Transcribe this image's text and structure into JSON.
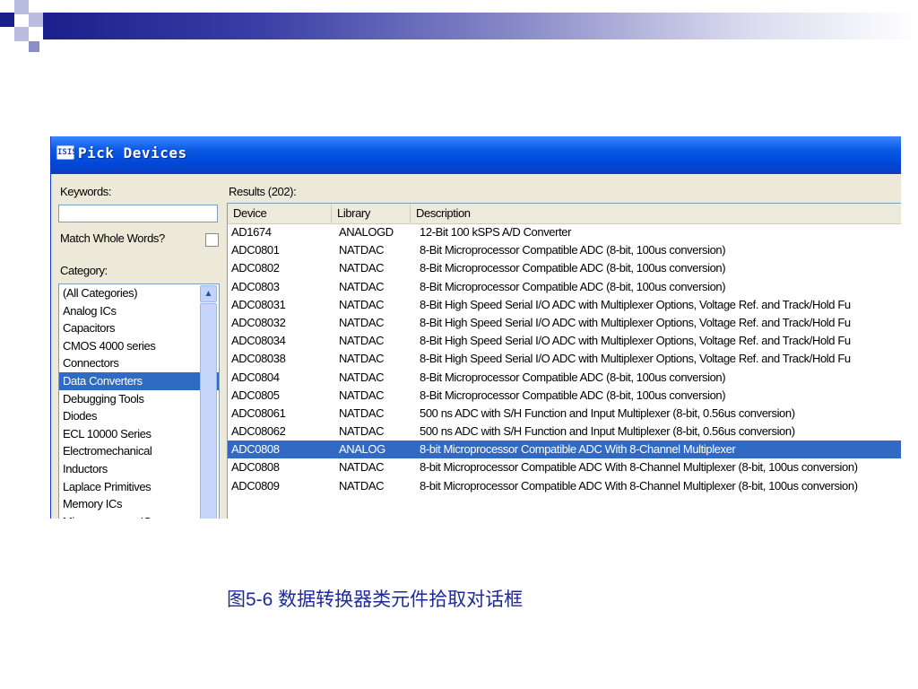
{
  "dialog": {
    "icon_text": "ISIS",
    "title": "Pick Devices",
    "keywords_label": "Keywords:",
    "keywords_value": "",
    "match_whole_words_label": "Match Whole Words?",
    "category_label": "Category:",
    "categories": [
      "(All Categories)",
      "Analog ICs",
      "Capacitors",
      "CMOS 4000 series",
      "Connectors",
      "Data Converters",
      "Debugging Tools",
      "Diodes",
      "ECL 10000 Series",
      "Electromechanical",
      "Inductors",
      "Laplace Primitives",
      "Memory ICs",
      "Microprocessor ICs"
    ],
    "selected_category": "Data Converters",
    "results_label": "Results (202):",
    "columns": [
      "Device",
      "Library",
      "Description"
    ],
    "rows": [
      {
        "device": "AD1674",
        "library": "ANALOGD",
        "description": "12-Bit 100 kSPS A/D Converter"
      },
      {
        "device": "ADC0801",
        "library": "NATDAC",
        "description": "8-Bit Microprocessor Compatible ADC (8-bit, 100us conversion)"
      },
      {
        "device": "ADC0802",
        "library": "NATDAC",
        "description": "8-Bit Microprocessor Compatible ADC (8-bit, 100us conversion)"
      },
      {
        "device": "ADC0803",
        "library": "NATDAC",
        "description": "8-Bit Microprocessor Compatible ADC (8-bit, 100us conversion)"
      },
      {
        "device": "ADC08031",
        "library": "NATDAC",
        "description": "8-Bit High Speed Serial I/O ADC with Multiplexer Options, Voltage Ref. and Track/Hold Fu"
      },
      {
        "device": "ADC08032",
        "library": "NATDAC",
        "description": "8-Bit High Speed Serial I/O ADC with Multiplexer Options, Voltage Ref. and Track/Hold Fu"
      },
      {
        "device": "ADC08034",
        "library": "NATDAC",
        "description": "8-Bit High Speed Serial I/O ADC with Multiplexer Options, Voltage Ref. and Track/Hold Fu"
      },
      {
        "device": "ADC08038",
        "library": "NATDAC",
        "description": "8-Bit High Speed Serial I/O ADC with Multiplexer Options, Voltage Ref. and Track/Hold Fu"
      },
      {
        "device": "ADC0804",
        "library": "NATDAC",
        "description": "8-Bit Microprocessor Compatible ADC (8-bit, 100us conversion)"
      },
      {
        "device": "ADC0805",
        "library": "NATDAC",
        "description": "8-Bit Microprocessor Compatible ADC (8-bit, 100us conversion)"
      },
      {
        "device": "ADC08061",
        "library": "NATDAC",
        "description": "500 ns ADC with S/H Function and Input Multiplexer (8-bit, 0.56us conversion)"
      },
      {
        "device": "ADC08062",
        "library": "NATDAC",
        "description": "500 ns ADC with S/H Function and Input Multiplexer (8-bit, 0.56us conversion)"
      },
      {
        "device": "ADC0808",
        "library": "ANALOG",
        "description": "8-bit Microprocessor Compatible ADC With 8-Channel Multiplexer"
      },
      {
        "device": "ADC0808",
        "library": "NATDAC",
        "description": "8-bit Microprocessor Compatible ADC With 8-Channel Multiplexer (8-bit, 100us conversion)"
      },
      {
        "device": "ADC0809",
        "library": "NATDAC",
        "description": "8-bit Microprocessor Compatible ADC With 8-Channel Multiplexer (8-bit, 100us conversion)"
      }
    ],
    "selected_row": 12
  },
  "caption": "图5-6  数据转换器类元件拾取对话框",
  "colors": {
    "accent": "#0a5ae6",
    "selection": "#316ac5",
    "dialog_face": "#ece9d8",
    "caption": "#1c2a9a"
  }
}
